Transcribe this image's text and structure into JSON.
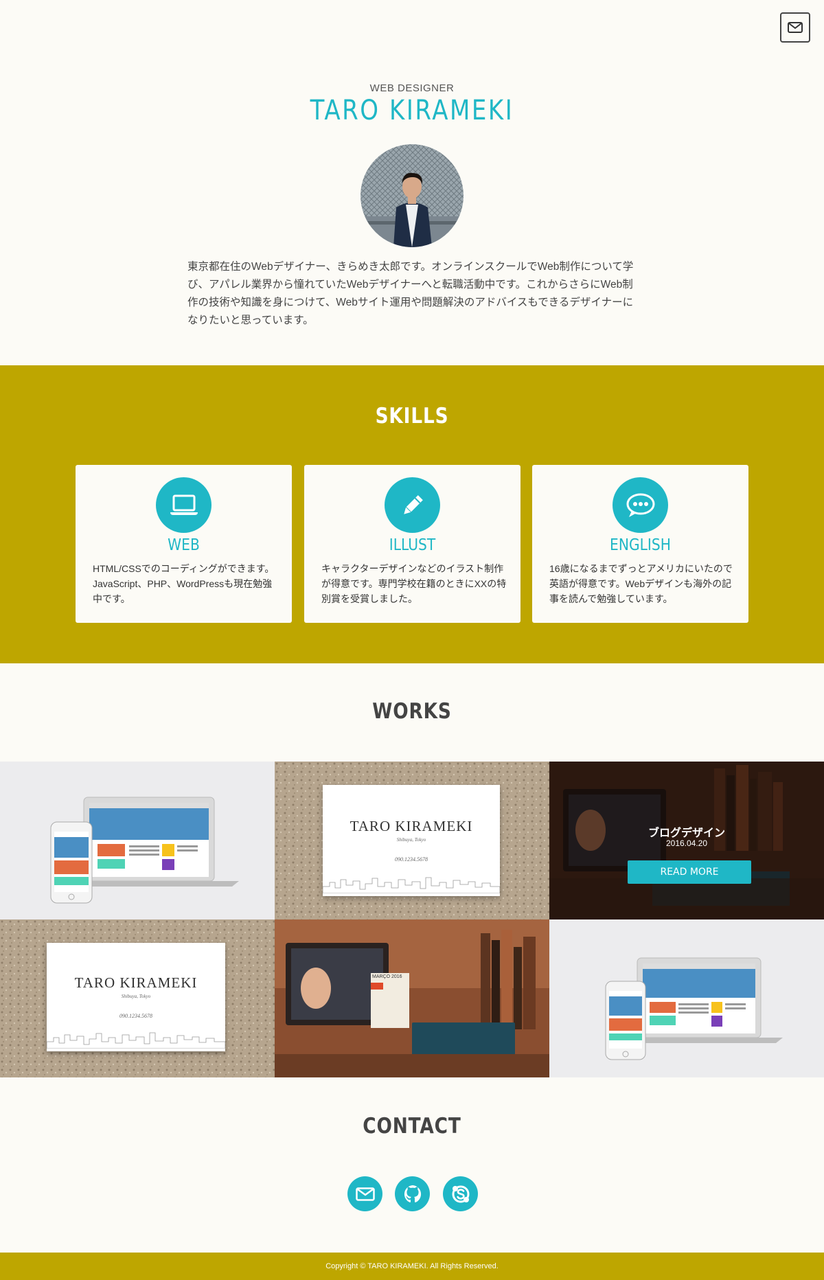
{
  "header": {
    "subtitle": "WEB DESIGNER",
    "name": "TARO KIRAMEKI",
    "mail_icon": "mail-icon",
    "intro": "東京都在住のWebデザイナー、きらめき太郎です。オンラインスクールでWeb制作について学び、アパレル業界から憧れていたWebデザイナーへと転職活動中です。これからさらにWeb制作の技術や知識を身につけて、Webサイト運用や問題解決のアドバイスもできるデザイナーになりたいと思っています。"
  },
  "skills": {
    "title": "SKILLS",
    "items": [
      {
        "name": "WEB",
        "icon": "laptop-icon",
        "desc": "HTML/CSSでのコーディングができます。JavaScript、PHP、WordPressも現在勉強中です。"
      },
      {
        "name": "ILLUST",
        "icon": "pencil-icon",
        "desc": "キャラクターデザインなどのイラスト制作が得意です。専門学校在籍のときにXXの特別賞を受賞しました。"
      },
      {
        "name": "ENGLISH",
        "icon": "chat-bubble-icon",
        "desc": "16歳になるまでずっとアメリカにいたので英語が得意です。Webデザインも海外の記事を読んで勉強しています。"
      }
    ]
  },
  "works": {
    "title": "WORKS",
    "card_name": "TARO KIRAMEKI",
    "card_sub": "Shibuya, Tokyo",
    "card_tel": "090.1234.5678",
    "hover": {
      "title": "ブログデザイン",
      "date": "2016.04.20",
      "button": "READ MORE"
    },
    "calendar_label": "MARÇO 2016"
  },
  "contact": {
    "title": "CONTACT",
    "icons": [
      "mail-icon",
      "github-icon",
      "skype-icon"
    ]
  },
  "footer": {
    "copyright": "Copyright © TARO KIRAMEKI. All Rights Reserved."
  },
  "colors": {
    "accent": "#1fb7c6",
    "mustard": "#bea600",
    "background": "#fcfbf6"
  }
}
